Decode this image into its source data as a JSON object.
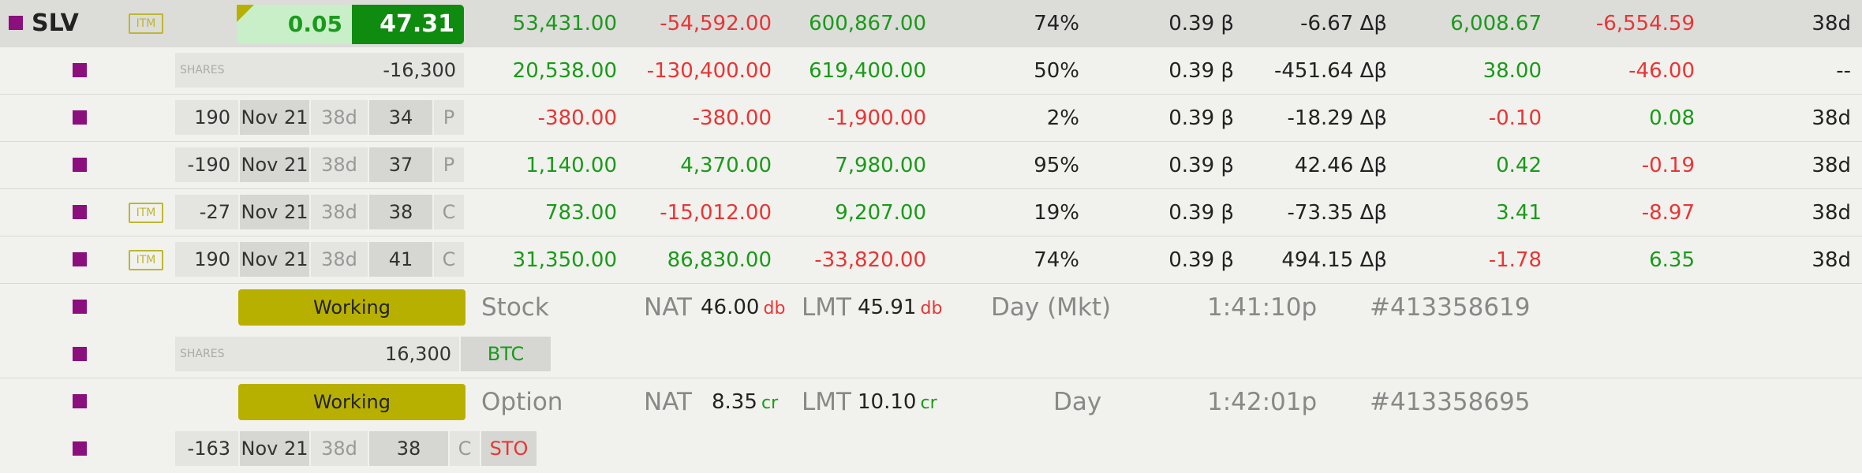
{
  "header": {
    "symbol": "SLV",
    "itm": "ITM",
    "change": "0.05",
    "price": "47.31",
    "c1": "53,431.00",
    "c2": "-54,592.00",
    "c3": "600,867.00",
    "pct": "74%",
    "beta": "0.39 β",
    "dbeta": "-6.67 Δβ",
    "c4": "6,008.67",
    "c5": "-6,554.59",
    "dte": "38d"
  },
  "positions": [
    {
      "shares_label": "SHARES",
      "qty": "-16,300",
      "c1": "20,538.00",
      "c2": "-130,400.00",
      "c3": "619,400.00",
      "pct": "50%",
      "beta": "0.39 β",
      "dbeta": "-451.64 Δβ",
      "c4": "38.00",
      "c5": "-46.00",
      "dte": "--"
    },
    {
      "itm": "",
      "qty": "190",
      "exp": "Nov 21",
      "days": "38d",
      "strike": "34",
      "type": "P",
      "c1": "-380.00",
      "c2": "-380.00",
      "c3": "-1,900.00",
      "pct": "2%",
      "beta": "0.39 β",
      "dbeta": "-18.29 Δβ",
      "c4": "-0.10",
      "c5": "0.08",
      "dte": "38d"
    },
    {
      "itm": "",
      "qty": "-190",
      "exp": "Nov 21",
      "days": "38d",
      "strike": "37",
      "type": "P",
      "c1": "1,140.00",
      "c2": "4,370.00",
      "c3": "7,980.00",
      "pct": "95%",
      "beta": "0.39 β",
      "dbeta": "42.46 Δβ",
      "c4": "0.42",
      "c5": "-0.19",
      "dte": "38d"
    },
    {
      "itm": "ITM",
      "qty": "-27",
      "exp": "Nov 21",
      "days": "38d",
      "strike": "38",
      "type": "C",
      "c1": "783.00",
      "c2": "-15,012.00",
      "c3": "9,207.00",
      "pct": "19%",
      "beta": "0.39 β",
      "dbeta": "-73.35 Δβ",
      "c4": "3.41",
      "c5": "-8.97",
      "dte": "38d"
    },
    {
      "itm": "ITM",
      "qty": "190",
      "exp": "Nov 21",
      "days": "38d",
      "strike": "41",
      "type": "C",
      "c1": "31,350.00",
      "c2": "86,830.00",
      "c3": "-33,820.00",
      "pct": "74%",
      "beta": "0.39 β",
      "dbeta": "494.15 Δβ",
      "c4": "-1.78",
      "c5": "6.35",
      "dte": "38d"
    }
  ],
  "orders": [
    {
      "status": "Working",
      "kind": "Stock",
      "nat_label": "NAT",
      "nat": "46.00",
      "nat_unit": "db",
      "lmt_label": "LMT",
      "lmt": "45.91",
      "lmt_unit": "db",
      "tif": "Day (Mkt)",
      "time": "1:41:10p",
      "id": "#413358619",
      "leg": {
        "shares_label": "SHARES",
        "qty": "16,300",
        "action": "BTC"
      }
    },
    {
      "status": "Working",
      "kind": "Option",
      "nat_label": "NAT",
      "nat": "8.35",
      "nat_unit": "cr",
      "lmt_label": "LMT",
      "lmt": "10.10",
      "lmt_unit": "cr",
      "tif": "Day",
      "time": "1:42:01p",
      "id": "#413358695",
      "leg": {
        "qty": "-163",
        "exp": "Nov 21",
        "days": "38d",
        "strike": "38",
        "type": "C",
        "action": "STO"
      }
    }
  ],
  "colors": {
    "green": "#1a9a1a",
    "red": "#e83535",
    "purple": "#8b0f7c",
    "itm": "#bdb632",
    "working": "#b8b000"
  }
}
